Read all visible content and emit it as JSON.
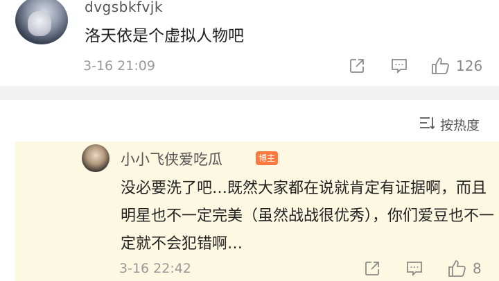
{
  "top_comment": {
    "username": "dvgsbkfvjk",
    "text": "洛天依是个虚拟人物吧",
    "time": "3-16 21:09",
    "likes": "126",
    "icons": [
      "share-icon",
      "comment-icon",
      "like-icon"
    ]
  },
  "sort": {
    "label": "按热度",
    "icon": "sort-icon"
  },
  "reply": {
    "username": "小小飞侠爱吃瓜",
    "badge": "博主",
    "text": "没必要洗了吧…既然大家都在说就肯定有证据啊，而且明星也不一定完美（虽然战战很优秀），你们爱豆也不一定就不会犯错啊…",
    "time": "3-16 22:42",
    "likes": "8",
    "background": "#fdf8e2"
  },
  "colors": {
    "badge": "#ff7a3c",
    "muted": "#999999",
    "separator": "#f2f2f2"
  }
}
